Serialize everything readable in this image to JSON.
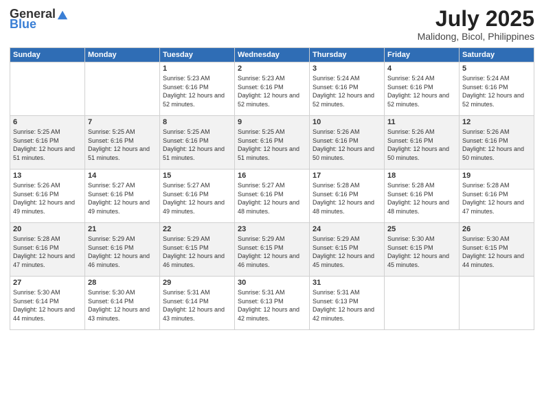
{
  "logo": {
    "general": "General",
    "blue": "Blue"
  },
  "header": {
    "monthYear": "July 2025",
    "location": "Malidong, Bicol, Philippines"
  },
  "columns": [
    "Sunday",
    "Monday",
    "Tuesday",
    "Wednesday",
    "Thursday",
    "Friday",
    "Saturday"
  ],
  "weeks": [
    [
      {
        "day": "",
        "info": ""
      },
      {
        "day": "",
        "info": ""
      },
      {
        "day": "1",
        "info": "Sunrise: 5:23 AM\nSunset: 6:16 PM\nDaylight: 12 hours and 52 minutes."
      },
      {
        "day": "2",
        "info": "Sunrise: 5:23 AM\nSunset: 6:16 PM\nDaylight: 12 hours and 52 minutes."
      },
      {
        "day": "3",
        "info": "Sunrise: 5:24 AM\nSunset: 6:16 PM\nDaylight: 12 hours and 52 minutes."
      },
      {
        "day": "4",
        "info": "Sunrise: 5:24 AM\nSunset: 6:16 PM\nDaylight: 12 hours and 52 minutes."
      },
      {
        "day": "5",
        "info": "Sunrise: 5:24 AM\nSunset: 6:16 PM\nDaylight: 12 hours and 52 minutes."
      }
    ],
    [
      {
        "day": "6",
        "info": "Sunrise: 5:25 AM\nSunset: 6:16 PM\nDaylight: 12 hours and 51 minutes."
      },
      {
        "day": "7",
        "info": "Sunrise: 5:25 AM\nSunset: 6:16 PM\nDaylight: 12 hours and 51 minutes."
      },
      {
        "day": "8",
        "info": "Sunrise: 5:25 AM\nSunset: 6:16 PM\nDaylight: 12 hours and 51 minutes."
      },
      {
        "day": "9",
        "info": "Sunrise: 5:25 AM\nSunset: 6:16 PM\nDaylight: 12 hours and 51 minutes."
      },
      {
        "day": "10",
        "info": "Sunrise: 5:26 AM\nSunset: 6:16 PM\nDaylight: 12 hours and 50 minutes."
      },
      {
        "day": "11",
        "info": "Sunrise: 5:26 AM\nSunset: 6:16 PM\nDaylight: 12 hours and 50 minutes."
      },
      {
        "day": "12",
        "info": "Sunrise: 5:26 AM\nSunset: 6:16 PM\nDaylight: 12 hours and 50 minutes."
      }
    ],
    [
      {
        "day": "13",
        "info": "Sunrise: 5:26 AM\nSunset: 6:16 PM\nDaylight: 12 hours and 49 minutes."
      },
      {
        "day": "14",
        "info": "Sunrise: 5:27 AM\nSunset: 6:16 PM\nDaylight: 12 hours and 49 minutes."
      },
      {
        "day": "15",
        "info": "Sunrise: 5:27 AM\nSunset: 6:16 PM\nDaylight: 12 hours and 49 minutes."
      },
      {
        "day": "16",
        "info": "Sunrise: 5:27 AM\nSunset: 6:16 PM\nDaylight: 12 hours and 48 minutes."
      },
      {
        "day": "17",
        "info": "Sunrise: 5:28 AM\nSunset: 6:16 PM\nDaylight: 12 hours and 48 minutes."
      },
      {
        "day": "18",
        "info": "Sunrise: 5:28 AM\nSunset: 6:16 PM\nDaylight: 12 hours and 48 minutes."
      },
      {
        "day": "19",
        "info": "Sunrise: 5:28 AM\nSunset: 6:16 PM\nDaylight: 12 hours and 47 minutes."
      }
    ],
    [
      {
        "day": "20",
        "info": "Sunrise: 5:28 AM\nSunset: 6:16 PM\nDaylight: 12 hours and 47 minutes."
      },
      {
        "day": "21",
        "info": "Sunrise: 5:29 AM\nSunset: 6:16 PM\nDaylight: 12 hours and 46 minutes."
      },
      {
        "day": "22",
        "info": "Sunrise: 5:29 AM\nSunset: 6:15 PM\nDaylight: 12 hours and 46 minutes."
      },
      {
        "day": "23",
        "info": "Sunrise: 5:29 AM\nSunset: 6:15 PM\nDaylight: 12 hours and 46 minutes."
      },
      {
        "day": "24",
        "info": "Sunrise: 5:29 AM\nSunset: 6:15 PM\nDaylight: 12 hours and 45 minutes."
      },
      {
        "day": "25",
        "info": "Sunrise: 5:30 AM\nSunset: 6:15 PM\nDaylight: 12 hours and 45 minutes."
      },
      {
        "day": "26",
        "info": "Sunrise: 5:30 AM\nSunset: 6:15 PM\nDaylight: 12 hours and 44 minutes."
      }
    ],
    [
      {
        "day": "27",
        "info": "Sunrise: 5:30 AM\nSunset: 6:14 PM\nDaylight: 12 hours and 44 minutes."
      },
      {
        "day": "28",
        "info": "Sunrise: 5:30 AM\nSunset: 6:14 PM\nDaylight: 12 hours and 43 minutes."
      },
      {
        "day": "29",
        "info": "Sunrise: 5:31 AM\nSunset: 6:14 PM\nDaylight: 12 hours and 43 minutes."
      },
      {
        "day": "30",
        "info": "Sunrise: 5:31 AM\nSunset: 6:13 PM\nDaylight: 12 hours and 42 minutes."
      },
      {
        "day": "31",
        "info": "Sunrise: 5:31 AM\nSunset: 6:13 PM\nDaylight: 12 hours and 42 minutes."
      },
      {
        "day": "",
        "info": ""
      },
      {
        "day": "",
        "info": ""
      }
    ]
  ]
}
